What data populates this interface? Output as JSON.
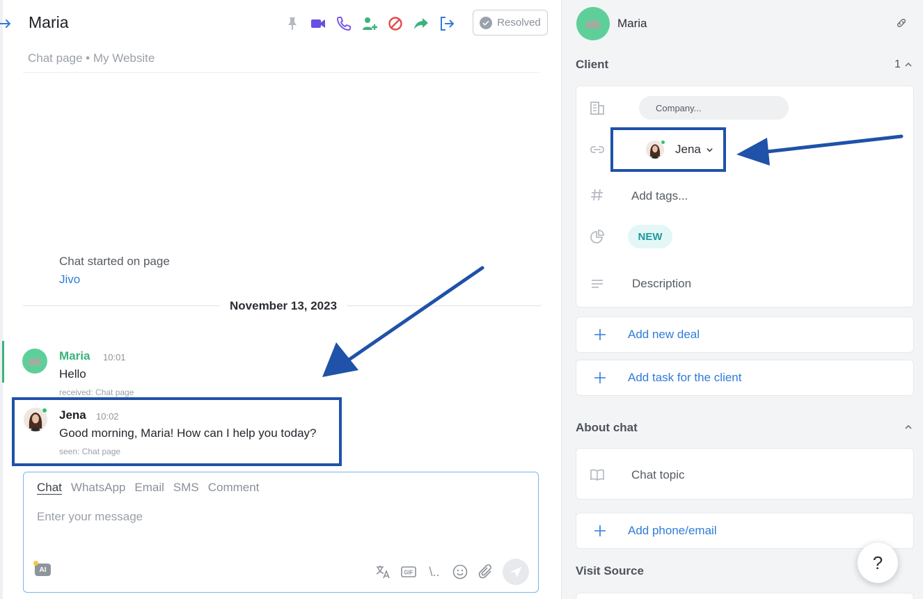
{
  "header": {
    "title": "Maria",
    "subtitle": "Chat page • My Website",
    "resolved_label": "Resolved"
  },
  "toolbar": {
    "icons": [
      "pin-icon",
      "video-call-icon",
      "phone-icon",
      "add-user-icon",
      "block-icon",
      "forward-icon",
      "leave-chat-icon"
    ],
    "colors": {
      "pin": "#b4b9bf",
      "video": "#6a4fe3",
      "phone": "#7b59e8",
      "add_user": "#3bb27c",
      "block": "#e54b4b",
      "forward": "#3bb27c",
      "leave": "#2f7bd9"
    }
  },
  "chat": {
    "started_label": "Chat started on page",
    "started_link": "Jivo",
    "date": "November 13, 2023",
    "messages": [
      {
        "name": "Maria",
        "time": "10:01",
        "text": "Hello",
        "meta": "received: Chat page",
        "name_color": "#3bb27c"
      },
      {
        "name": "Jena",
        "time": "10:02",
        "text": "Good morning, Maria! How can I help you today?",
        "meta": "seen: Chat page",
        "name_color": "#1b1e23"
      }
    ]
  },
  "composer": {
    "tabs": [
      "Chat",
      "WhatsApp",
      "Email",
      "SMS",
      "Comment"
    ],
    "active_tab": "Chat",
    "placeholder": "Enter your message",
    "ai_label": "AI",
    "gif_label": "GIF",
    "snippet_label": "\\.."
  },
  "sidebar": {
    "client_name": "Maria",
    "client_section": {
      "title": "Client",
      "count": "1"
    },
    "company_placeholder": "Company...",
    "agent": "Jena",
    "tags_placeholder": "Add tags...",
    "status_badge": "NEW",
    "description_placeholder": "Description",
    "add_deal": "Add new deal",
    "add_task": "Add task for the client",
    "about_chat": {
      "title": "About chat"
    },
    "chat_topic": "Chat topic",
    "add_contact": "Add phone/email",
    "visit_source": {
      "title": "Visit Source"
    }
  },
  "help_label": "?",
  "colors": {
    "accent": "#2f7bd9",
    "highlight": "#1f52a8",
    "client_avatar": "#5fcf9a"
  }
}
